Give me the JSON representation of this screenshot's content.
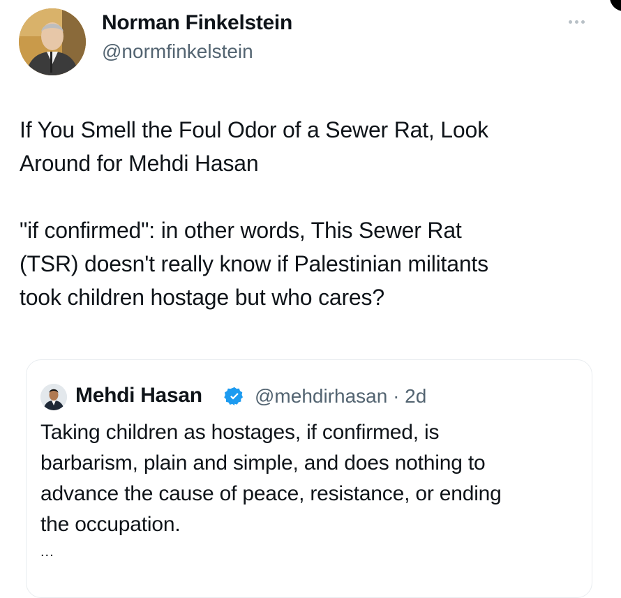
{
  "author": {
    "name": "Norman Finkelstein",
    "handle": "@normfinkelstein"
  },
  "tweet": {
    "paragraphs": [
      "If You Smell the Foul Odor of a Sewer Rat, Look\nAround for Mehdi Hasan",
      "\"if confirmed\": in other words, This Sewer Rat\n(TSR) doesn't really know if Palestinian militants\ntook children hostage but who cares?"
    ]
  },
  "quoted_tweet": {
    "name": "Mehdi Hasan",
    "handle_time": "@mehdirhasan · 2d",
    "text": "Taking children as hostages, if confirmed, is\nbarbarism, plain and simple, and does nothing to\nadvance the cause of peace, resistance, or ending\nthe occupation.",
    "show_more": "..."
  },
  "icons": {
    "more": "more-options-icon",
    "verified": "verified-badge-icon"
  },
  "colors": {
    "text": "#0f1419",
    "secondary": "#536471",
    "verified": "#1d9bf0"
  }
}
